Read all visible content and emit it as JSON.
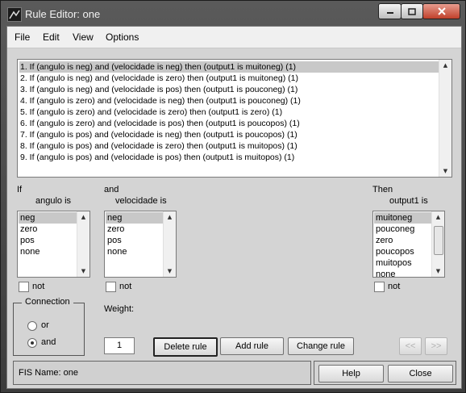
{
  "window": {
    "title": "Rule Editor: one"
  },
  "menu": [
    "File",
    "Edit",
    "View",
    "Options"
  ],
  "rules": {
    "selected_index": 0,
    "items": [
      "1. If (angulo is neg) and (velocidade is neg) then (output1 is muitoneg) (1)",
      "2. If (angulo is neg) and (velocidade is zero) then (output1 is muitoneg) (1)",
      "3. If (angulo is neg) and (velocidade is pos) then (output1 is pouconeg) (1)",
      "4. If (angulo is zero) and (velocidade is neg) then (output1 is pouconeg) (1)",
      "5. If (angulo is zero) and (velocidade is zero) then (output1 is zero) (1)",
      "6. If (angulo is zero) and (velocidade is pos) then (output1 is poucopos) (1)",
      "7. If (angulo is pos) and (velocidade is neg) then (output1 is poucopos) (1)",
      "8. If (angulo is pos) and (velocidade is zero) then (output1 is muitopos) (1)",
      "9. If (angulo is pos) and (velocidade is pos) then (output1 is muitopos) (1)"
    ]
  },
  "antecedent1": {
    "prefix": "If",
    "label": "angulo is",
    "options": [
      "neg",
      "zero",
      "pos",
      "none"
    ],
    "selected": "neg",
    "not_label": "not"
  },
  "antecedent2": {
    "prefix": "and",
    "label": "velocidade is",
    "options": [
      "neg",
      "zero",
      "pos",
      "none"
    ],
    "selected": "neg",
    "not_label": "not"
  },
  "consequent": {
    "prefix": "Then",
    "label": "output1 is",
    "options": [
      "muitoneg",
      "pouconeg",
      "zero",
      "poucopos",
      "muitopos",
      "none"
    ],
    "selected": "muitoneg",
    "not_label": "not"
  },
  "connection": {
    "title": "Connection",
    "options": [
      "or",
      "and"
    ],
    "selected": "and"
  },
  "weight": {
    "label": "Weight:",
    "value": "1"
  },
  "buttons": {
    "delete": "Delete rule",
    "add": "Add rule",
    "change": "Change rule",
    "prev": "<<",
    "next": ">>",
    "help": "Help",
    "close": "Close"
  },
  "status": "FIS Name: one",
  "colors": {
    "selection": "#c8c8c8",
    "panel": "#d4d4d4"
  }
}
